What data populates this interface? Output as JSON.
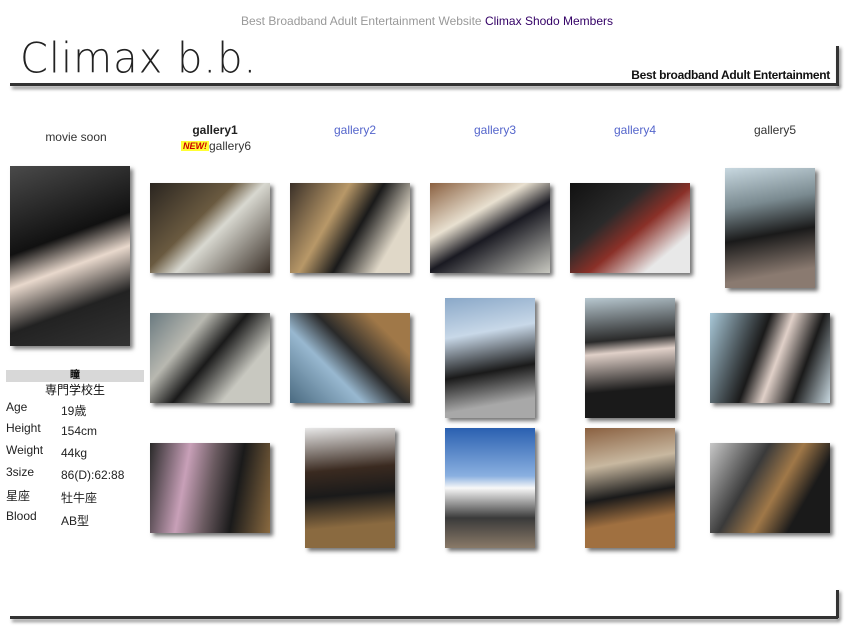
{
  "top_banner": {
    "text": "Best Broadband Adult Entertainment Website",
    "link": "Climax Shodo Members"
  },
  "header": {
    "logo": "Climax b.b.",
    "tagline": "Best broadband Adult Entertainment"
  },
  "nav": {
    "movie": "movie soon",
    "gallery1": "gallery1",
    "new_badge": "NEW!",
    "gallery6": "gallery6",
    "gallery2": "gallery2",
    "gallery3": "gallery3",
    "gallery4": "gallery4",
    "gallery5": "gallery5"
  },
  "profile": {
    "name": "瞳",
    "school": "専門学校生",
    "rows": [
      {
        "label": "Age",
        "value": "19歳"
      },
      {
        "label": "Height",
        "value": "154cm"
      },
      {
        "label": "Weight",
        "value": "44kg"
      },
      {
        "label": "3size",
        "value": "86(D):62:88"
      },
      {
        "label": "星座",
        "value": "牡牛座"
      },
      {
        "label": "Blood",
        "value": "AB型"
      }
    ]
  },
  "colors": {
    "accent_link": "#5566cc",
    "banner_link": "#330066",
    "badge_bg": "#ffff33"
  }
}
